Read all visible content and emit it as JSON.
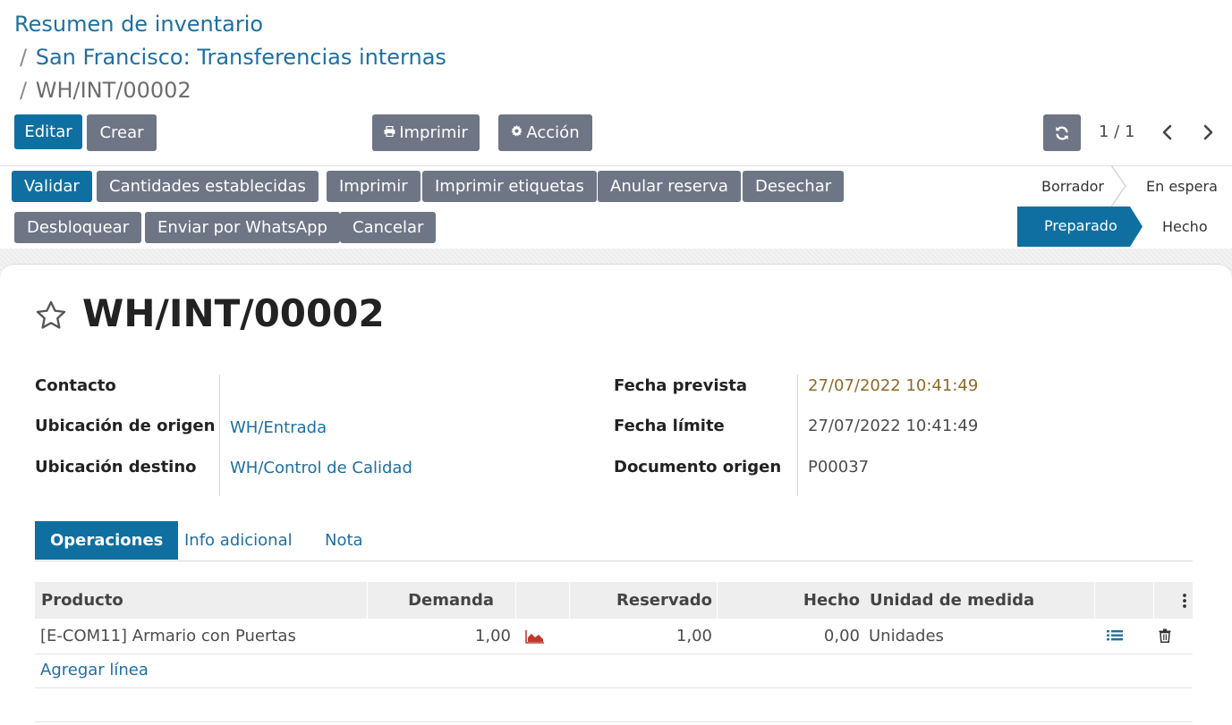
{
  "breadcrumbs": [
    {
      "label": "Resumen de inventario"
    },
    {
      "label": "San Francisco: Transferencias internas"
    },
    {
      "label": "WH/INT/00002"
    }
  ],
  "breadcrumb_separator": "/",
  "toolbar": {
    "edit_label": "Editar",
    "create_label": "Crear",
    "print_label": "Imprimir",
    "action_label": "Acción",
    "print_icon": "printer-icon",
    "action_icon": "gear-icon",
    "refresh_icon": "refresh-icon"
  },
  "pager": {
    "value": "1 / 1",
    "prev_icon": "chevron-left-icon",
    "next_icon": "chevron-right-icon"
  },
  "status_buttons": {
    "validate": "Validar",
    "set_quantities": "Cantidades establecidas",
    "print": "Imprimir",
    "print_labels": "Imprimir etiquetas",
    "unreserve": "Anular reserva",
    "scrap": "Desechar",
    "unlock": "Desbloquear",
    "whatsapp": "Enviar por WhatsApp",
    "cancel": "Cancelar"
  },
  "stages": {
    "draft": "Borrador",
    "waiting": "En espera",
    "ready": "Preparado",
    "done": "Hecho",
    "current": "Preparado"
  },
  "record": {
    "title": "WH/INT/00002",
    "favorite_icon": "star-icon",
    "fields": {
      "contact_label": "Contacto",
      "contact_value": "",
      "source_label": "Ubicación de origen",
      "source_value": "WH/Entrada",
      "dest_label": "Ubicación destino",
      "dest_value": "WH/Control de Calidad",
      "scheduled_label": "Fecha prevista",
      "scheduled_value": "27/07/2022 10:41:49",
      "deadline_label": "Fecha límite",
      "deadline_value": "27/07/2022 10:41:49",
      "origin_label": "Documento origen",
      "origin_value": "P00037"
    }
  },
  "tabs": [
    {
      "label": "Operaciones",
      "active": true
    },
    {
      "label": "Info adicional",
      "active": false
    },
    {
      "label": "Nota",
      "active": false
    }
  ],
  "table": {
    "headers": {
      "product": "Producto",
      "demand": "Demanda",
      "reserved": "Reservado",
      "done": "Hecho",
      "uom": "Unidad de medida"
    },
    "rows": [
      {
        "product": "[E-COM11] Armario con Puertas",
        "demand": "1,00",
        "reserved": "1,00",
        "done": "0,00",
        "uom": "Unidades",
        "forecast_icon": "area-chart-icon",
        "detail_icon": "list-icon",
        "delete_icon": "trash-icon"
      }
    ],
    "add_line": "Agregar línea",
    "options_icon": "kebab-menu-icon"
  },
  "colors": {
    "primary": "#0f6fa0",
    "secondary": "#6e7585",
    "link": "#1f6fa0",
    "warning_date": "#8f6a2a",
    "forecast_chart": "#c0392b"
  }
}
